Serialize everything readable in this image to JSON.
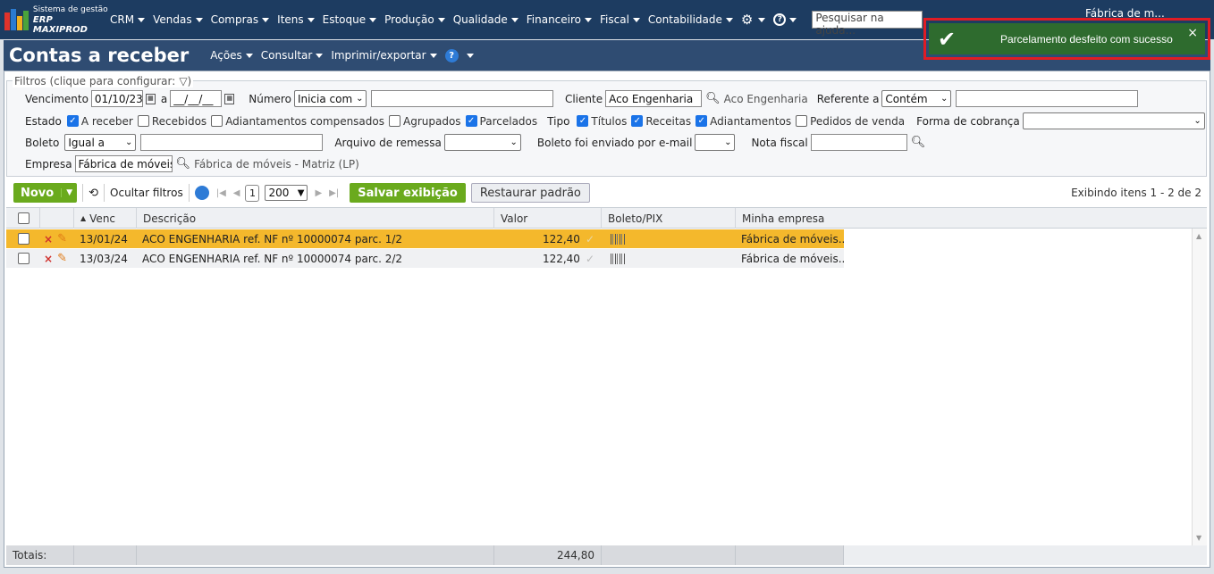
{
  "app": {
    "logo_line1": "Sistema de gestão",
    "logo_line2": "ERP MAXIPROD",
    "menu": [
      "CRM",
      "Vendas",
      "Compras",
      "Itens",
      "Estoque",
      "Produção",
      "Qualidade",
      "Financeiro",
      "Fiscal",
      "Contabilidade"
    ],
    "search_placeholder": "Pesquisar na ajuda...",
    "company": "Fábrica de m..."
  },
  "title": {
    "text": "Contas a receber",
    "menus": [
      "Ações",
      "Consultar",
      "Imprimir/exportar"
    ]
  },
  "filters": {
    "legend": "Filtros (clique para configurar:",
    "vencimento_label": "Vencimento",
    "vencimento_from": "01/10/23",
    "a_label": "a",
    "vencimento_to": "__/__/__",
    "numero_label": "Número",
    "numero_mode": "Inicia com",
    "cliente_label": "Cliente",
    "cliente_value": "Aco Engenharia",
    "cliente_name": "Aco Engenharia",
    "referente_label": "Referente a",
    "referente_mode": "Contém",
    "estado_label": "Estado",
    "estado_options": [
      {
        "label": "A receber",
        "checked": true
      },
      {
        "label": "Recebidos",
        "checked": false
      },
      {
        "label": "Adiantamentos compensados",
        "checked": false
      },
      {
        "label": "Agrupados",
        "checked": false
      },
      {
        "label": "Parcelados",
        "checked": true
      }
    ],
    "tipo_label": "Tipo",
    "tipo_options": [
      {
        "label": "Títulos",
        "checked": true
      },
      {
        "label": "Receitas",
        "checked": true
      },
      {
        "label": "Adiantamentos",
        "checked": true
      },
      {
        "label": "Pedidos de venda",
        "checked": false
      }
    ],
    "forma_label": "Forma de cobrança",
    "boleto_label": "Boleto",
    "boleto_mode": "Igual a",
    "arquivo_label": "Arquivo de remessa",
    "email_label": "Boleto foi enviado por e-mail",
    "nota_label": "Nota fiscal",
    "empresa_label": "Empresa",
    "empresa_value": "Fábrica de móveis -",
    "empresa_name": "Fábrica de móveis - Matriz (LP)"
  },
  "toolbar": {
    "new_label": "Novo",
    "hide_filters": "Ocultar filtros",
    "page": "1",
    "page_size": "200",
    "save_view": "Salvar exibição",
    "restore_default": "Restaurar padrão",
    "showing": "Exibindo itens 1 - 2 de 2"
  },
  "grid": {
    "columns": [
      "Venc",
      "Descrição",
      "Valor",
      "Boleto/PIX",
      "Minha empresa"
    ],
    "rows": [
      {
        "venc": "13/01/24",
        "descricao": "ACO ENGENHARIA ref. NF nº 10000074 parc. 1/2",
        "valor": "122,40",
        "empresa": "Fábrica de móveis..."
      },
      {
        "venc": "13/03/24",
        "descricao": "ACO ENGENHARIA ref. NF nº 10000074 parc. 2/2",
        "valor": "122,40",
        "empresa": "Fábrica de móveis..."
      }
    ],
    "totals_label": "Totais:",
    "totals_value": "244,80"
  },
  "toast": {
    "message": "Parcelamento desfeito com sucesso"
  },
  "colors": {
    "nav_bg": "#1d3c61",
    "title_bg": "#2f4c72",
    "green": "#6aaa1d",
    "selected_row": "#f4b82c",
    "toast_bg": "#2e6b2e",
    "highlight_frame": "#e01c24"
  }
}
